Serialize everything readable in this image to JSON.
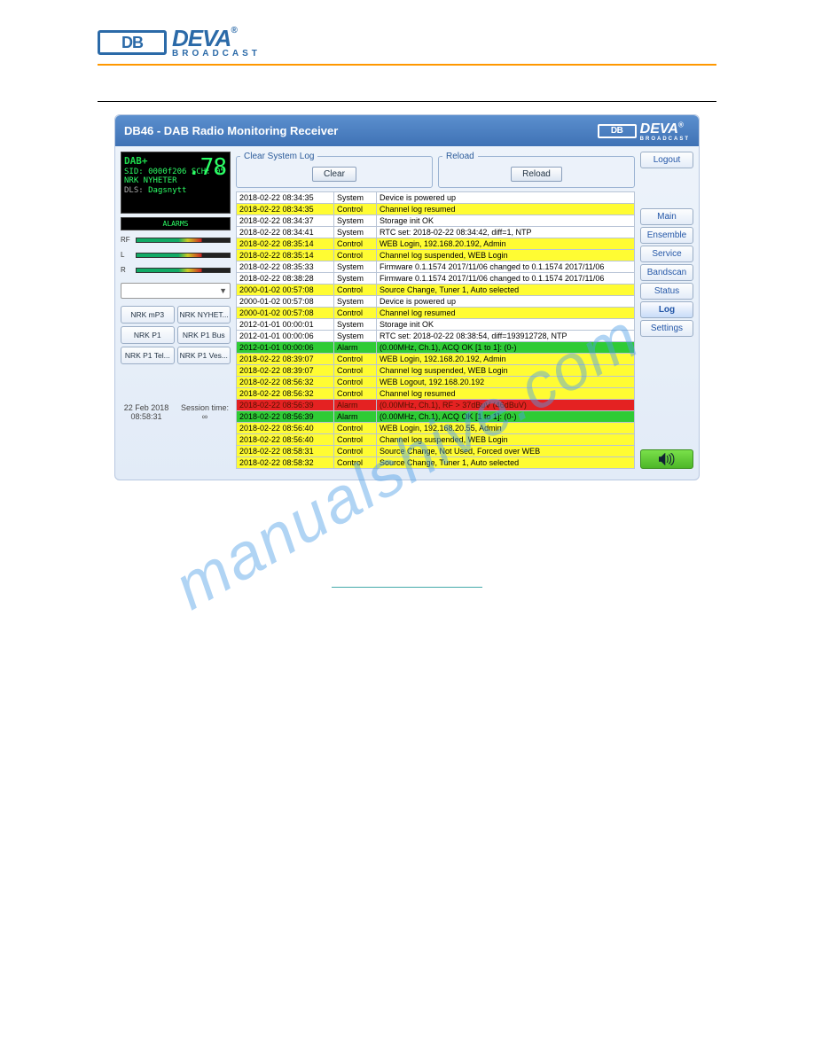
{
  "brand": {
    "deva": "DEVA",
    "reg": "®",
    "sub": "BROADCAST",
    "mark": "DB"
  },
  "header": {
    "title": "DB46 - DAB Radio Monitoring Receiver"
  },
  "lcd": {
    "dabplus": "DAB+",
    "bignum": ".78",
    "sid_line": "SID: 0000f206  SCH: 05",
    "name": "NRK NYHETER",
    "dls_label": "DLS:",
    "dls_value": "Dagsnytt",
    "alarms": "ALARMS"
  },
  "vu": {
    "rf": "RF",
    "l": "L",
    "r": "R"
  },
  "presets": [
    "NRK mP3",
    "NRK NYHET...",
    "NRK P1",
    "NRK P1 Bus",
    "NRK P1 Tel...",
    "NRK P1 Ves..."
  ],
  "footer": {
    "date": "22 Feb 2018",
    "time": "08:58:31",
    "session_label": "Session time:",
    "session_val": "∞"
  },
  "panels": {
    "clear_legend": "Clear System Log",
    "clear_btn": "Clear",
    "reload_legend": "Reload",
    "reload_btn": "Reload"
  },
  "nav": {
    "logout": "Logout",
    "items": [
      "Main",
      "Ensemble",
      "Service",
      "Bandscan",
      "Status",
      "Log",
      "Settings"
    ],
    "active": "Log"
  },
  "log_rows": [
    {
      "t": "2018-02-22 08:34:35",
      "c": "System",
      "m": "Device is powered up",
      "cls": "row-white"
    },
    {
      "t": "2018-02-22 08:34:35",
      "c": "Control",
      "m": "Channel log resumed",
      "cls": "row-yellow"
    },
    {
      "t": "2018-02-22 08:34:37",
      "c": "System",
      "m": "Storage init OK",
      "cls": "row-white"
    },
    {
      "t": "2018-02-22 08:34:41",
      "c": "System",
      "m": "RTC set: 2018-02-22 08:34:42, diff=1, NTP",
      "cls": "row-white"
    },
    {
      "t": "2018-02-22 08:35:14",
      "c": "Control",
      "m": "WEB Login, 192.168.20.192, Admin",
      "cls": "row-yellow"
    },
    {
      "t": "2018-02-22 08:35:14",
      "c": "Control",
      "m": "Channel log suspended, WEB Login",
      "cls": "row-yellow"
    },
    {
      "t": "2018-02-22 08:35:33",
      "c": "System",
      "m": "Firmware 0.1.1574 2017/11/06 changed to 0.1.1574 2017/11/06",
      "cls": "row-white"
    },
    {
      "t": "2018-02-22 08:38:28",
      "c": "System",
      "m": "Firmware 0.1.1574 2017/11/06 changed to 0.1.1574 2017/11/06",
      "cls": "row-white"
    },
    {
      "t": "2000-01-02 00:57:08",
      "c": "Control",
      "m": "Source Change, Tuner 1, Auto selected",
      "cls": "row-yellow"
    },
    {
      "t": "2000-01-02 00:57:08",
      "c": "System",
      "m": "Device is powered up",
      "cls": "row-white"
    },
    {
      "t": "2000-01-02 00:57:08",
      "c": "Control",
      "m": "Channel log resumed",
      "cls": "row-yellow"
    },
    {
      "t": "2012-01-01 00:00:01",
      "c": "System",
      "m": "Storage init OK",
      "cls": "row-white"
    },
    {
      "t": "2012-01-01 00:00:06",
      "c": "System",
      "m": "RTC set: 2018-02-22 08:38:54, diff=193912728, NTP",
      "cls": "row-white"
    },
    {
      "t": "2012-01-01 00:00:06",
      "c": "Alarm",
      "m": "(0.00MHz, Ch.1), ACQ OK [1 to 1]: (0-)",
      "cls": "row-green"
    },
    {
      "t": "2018-02-22 08:39:07",
      "c": "Control",
      "m": "WEB Login, 192.168.20.192, Admin",
      "cls": "row-yellow"
    },
    {
      "t": "2018-02-22 08:39:07",
      "c": "Control",
      "m": "Channel log suspended, WEB Login",
      "cls": "row-yellow"
    },
    {
      "t": "2018-02-22 08:56:32",
      "c": "Control",
      "m": "WEB Logout, 192.168.20.192",
      "cls": "row-yellow"
    },
    {
      "t": "2018-02-22 08:56:32",
      "c": "Control",
      "m": "Channel log resumed",
      "cls": "row-yellow"
    },
    {
      "t": "2018-02-22 08:56:39",
      "c": "Alarm",
      "m": "(0.00MHz, Ch.1), RF > 37dBuV (46dBuV)",
      "cls": "row-red"
    },
    {
      "t": "2018-02-22 08:56:39",
      "c": "Alarm",
      "m": "(0.00MHz, Ch.1), ACQ OK [1 to 1]: (0-)",
      "cls": "row-green"
    },
    {
      "t": "2018-02-22 08:56:40",
      "c": "Control",
      "m": "WEB Login, 192.168.20.55, Admin",
      "cls": "row-yellow"
    },
    {
      "t": "2018-02-22 08:56:40",
      "c": "Control",
      "m": "Channel log suspended, WEB Login",
      "cls": "row-yellow"
    },
    {
      "t": "2018-02-22 08:58:31",
      "c": "Control",
      "m": "Source Change, Not Used, Forced over WEB",
      "cls": "row-yellow"
    },
    {
      "t": "2018-02-22 08:58:32",
      "c": "Control",
      "m": "Source Change, Tuner 1, Auto selected",
      "cls": "row-yellow"
    }
  ]
}
